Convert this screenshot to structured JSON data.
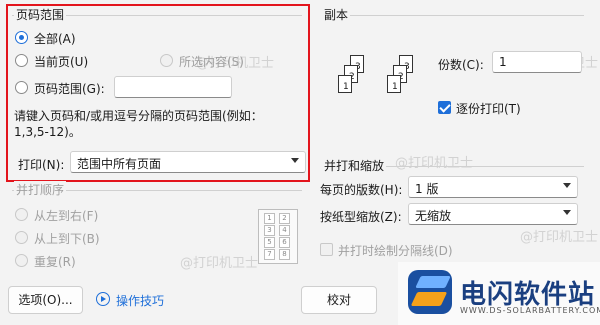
{
  "page_range": {
    "title": "页码范围",
    "all": "全部(A)",
    "current": "当前页(U)",
    "selection": "所选内容(S)",
    "range": "页码范围(G):",
    "range_value": "",
    "hint_line1": "请键入页码和/或用逗号分隔的页码范围(例如：",
    "hint_line2": "1,3,5-12)。"
  },
  "print_what": {
    "label": "打印(N):",
    "value": "范围中所有页面"
  },
  "collate_order": {
    "title": "并打顺序",
    "left_to_right": "从左到右(F)",
    "top_to_bottom": "从上到下(B)",
    "repeat": "重复(R)",
    "grid_numbers": [
      "1",
      "2",
      "3",
      "4",
      "5",
      "6",
      "7",
      "8"
    ]
  },
  "copies": {
    "title": "副本",
    "label": "份数(C):",
    "value": "1",
    "collate": "逐份打印(T)",
    "stack_a": [
      "3",
      "2",
      "1"
    ],
    "stack_b": [
      "3",
      "2",
      "1"
    ]
  },
  "zoom": {
    "title": "并打和缩放",
    "pages_per_sheet_label": "每页的版数(H):",
    "pages_per_sheet_value": "1 版",
    "scale_label": "按纸型缩放(Z):",
    "scale_value": "无缩放",
    "draw_borders": "并打时绘制分隔线(D)"
  },
  "footer": {
    "options": "选项(O)...",
    "tips": "操作技巧",
    "proofread": "校对"
  },
  "brand": {
    "name": "电闪软件站",
    "url": "WWW.DS-SOLARBATTERY.COM"
  },
  "watermark": "@打印机卫士",
  "colors": {
    "accent": "#1e6fd9",
    "highlight": "#e3141c",
    "brand_blue": "#1a4fa0",
    "brand_orange": "#f5a11a"
  }
}
